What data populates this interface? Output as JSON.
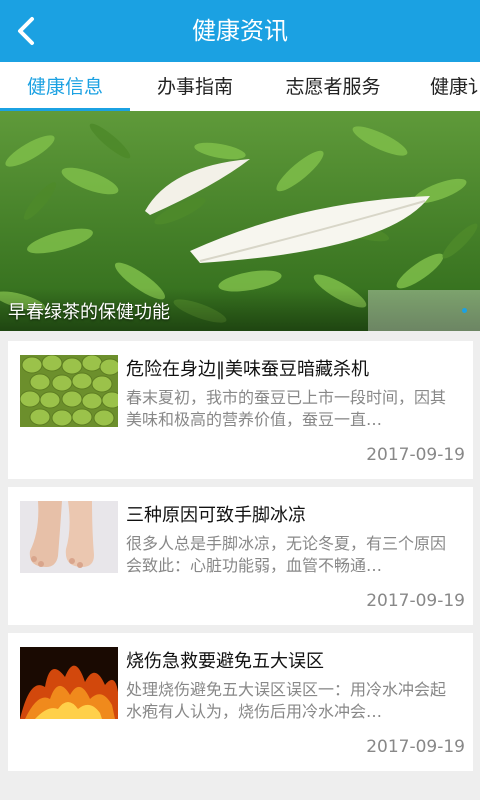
{
  "header": {
    "title": "健康资讯",
    "back_icon": "chevron-left-icon"
  },
  "tabs": [
    {
      "label": "健康信息",
      "active": true
    },
    {
      "label": "办事指南",
      "active": false
    },
    {
      "label": "志愿者服务",
      "active": false
    },
    {
      "label": "健康讠",
      "active": false
    }
  ],
  "banner": {
    "caption": "早春绿茶的保健功能"
  },
  "articles": [
    {
      "title": "危险在身边‖美味蚕豆暗藏杀机",
      "summary": "春末夏初，我市的蚕豆已上市一段时间，因其美味和极高的营养价值，蚕豆一直…",
      "date": "2017-09-19"
    },
    {
      "title": "三种原因可致手脚冰凉",
      "summary": "很多人总是手脚冰凉，无论冬夏，有三个原因会致此：心脏功能弱，血管不畅通…",
      "date": "2017-09-19"
    },
    {
      "title": "烧伤急救要避免五大误区",
      "summary": "处理烧伤避免五大误区误区一：用冷水冲会起水疱有人认为，烧伤后用冷水冲会…",
      "date": "2017-09-19"
    }
  ],
  "colors": {
    "accent": "#1ba1e2"
  }
}
